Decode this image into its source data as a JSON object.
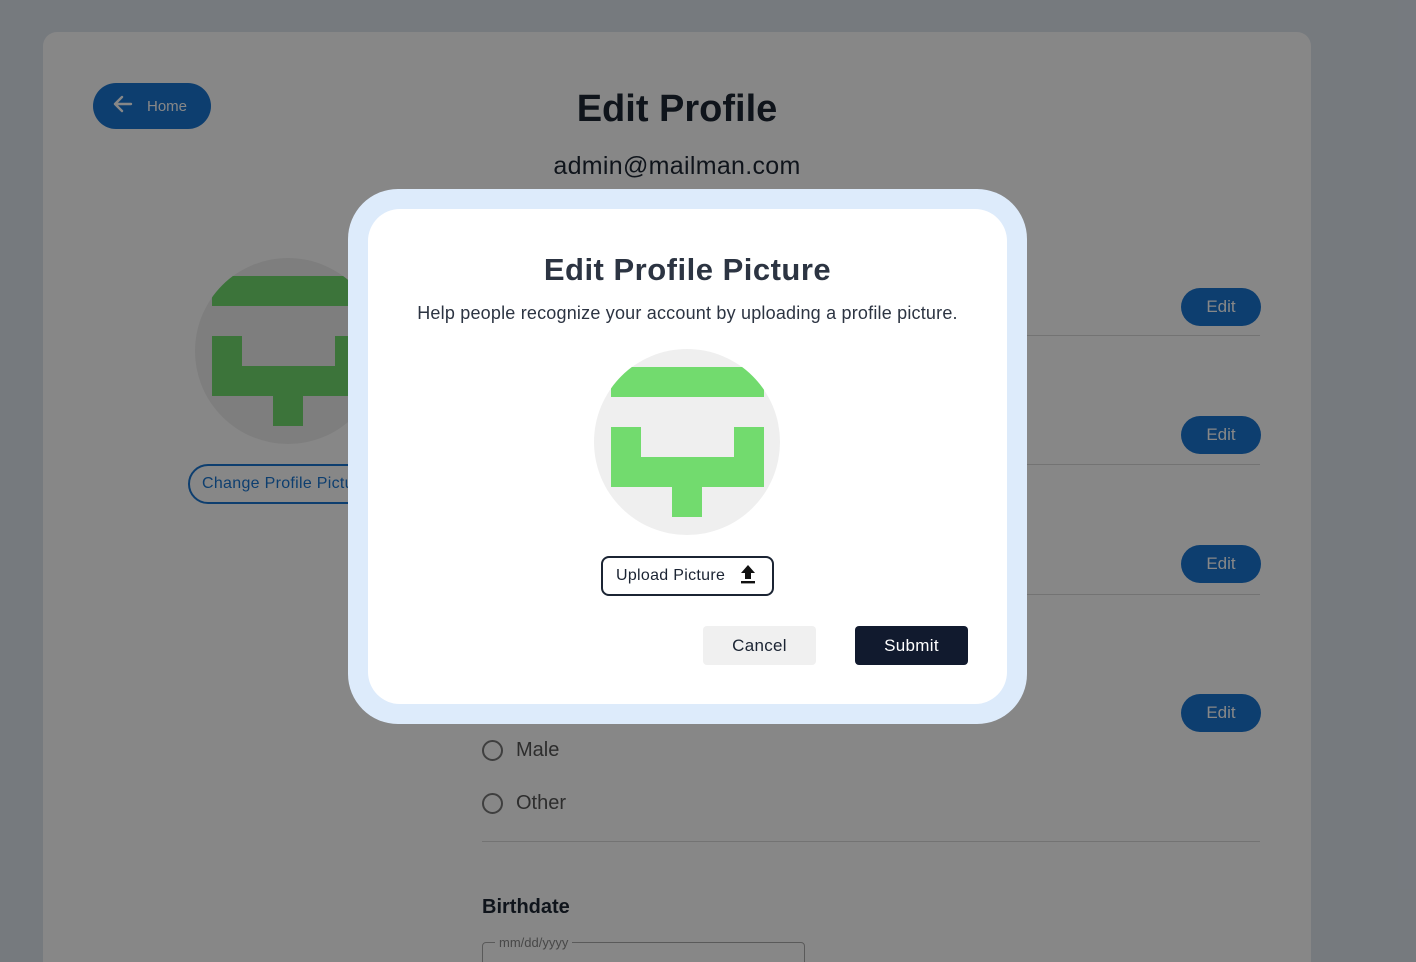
{
  "page": {
    "home_label": "Home",
    "title": "Edit Profile",
    "email": "admin@mailman.com",
    "change_picture_label": "Change Profile Picture",
    "edit_label": "Edit",
    "gender_options": [
      "Male",
      "Other"
    ],
    "birthdate_label": "Birthdate",
    "birthdate_placeholder": "mm/dd/yyyy",
    "accent_color": "#1976d2"
  },
  "modal": {
    "title": "Edit Profile Picture",
    "subtitle": "Help people recognize your account by uploading a profile picture.",
    "upload_label": "Upload Picture",
    "cancel_label": "Cancel",
    "submit_label": "Submit",
    "avatar_color": "#72db6e",
    "frame_color": "#ddebfb",
    "submit_color": "#111a2e"
  },
  "icons": {
    "home": "arrow-left-icon",
    "upload": "upload-icon",
    "avatar": "identicon-avatar"
  }
}
